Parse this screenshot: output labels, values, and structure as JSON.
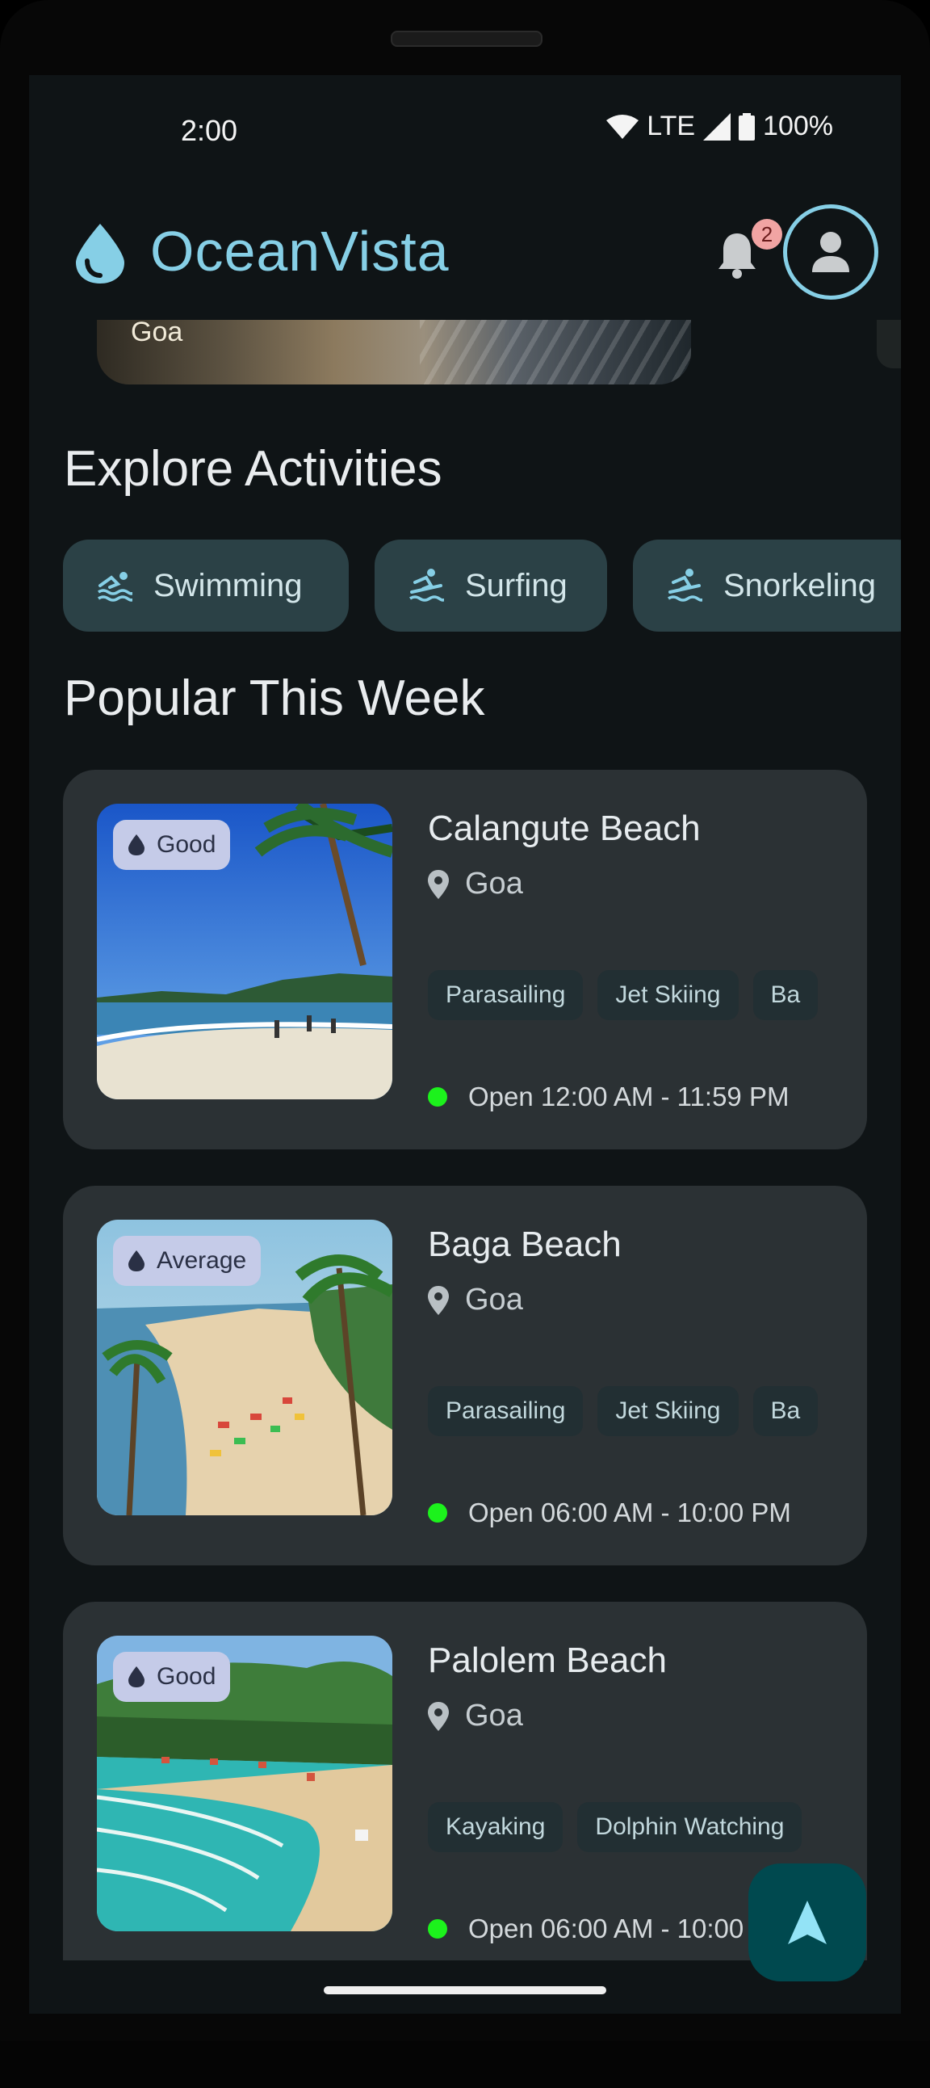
{
  "status_bar": {
    "time": "2:00",
    "network": "LTE",
    "battery": "100%"
  },
  "app": {
    "title": "OceanVista",
    "notifications": "2"
  },
  "hero": {
    "location": "Goa"
  },
  "sections": {
    "activities_title": "Explore Activities",
    "popular_title": "Popular This Week"
  },
  "activities": [
    {
      "label": "Swimming",
      "icon": "swimming-icon"
    },
    {
      "label": "Surfing",
      "icon": "surfing-icon"
    },
    {
      "label": "Snorkeling",
      "icon": "surfing-icon"
    }
  ],
  "beaches": [
    {
      "name": "Calangute Beach",
      "location": "Goa",
      "quality": "Good",
      "tags": [
        "Parasailing",
        "Jet Skiing",
        "Ba"
      ],
      "hours": "Open 12:00 AM - 11:59 PM"
    },
    {
      "name": "Baga Beach",
      "location": "Goa",
      "quality": "Average",
      "tags": [
        "Parasailing",
        "Jet Skiing",
        "Ba"
      ],
      "hours": "Open 06:00 AM - 10:00 PM"
    },
    {
      "name": "Palolem Beach",
      "location": "Goa",
      "quality": "Good",
      "tags": [
        "Kayaking",
        "Dolphin Watching"
      ],
      "hours": "Open 06:00 AM - 10:00 PM"
    }
  ],
  "colors": {
    "accent": "#86cfe6",
    "card": "#2b3134",
    "chip": "#2b4146",
    "open_dot": "#1cf21c",
    "fab": "#00494f"
  }
}
